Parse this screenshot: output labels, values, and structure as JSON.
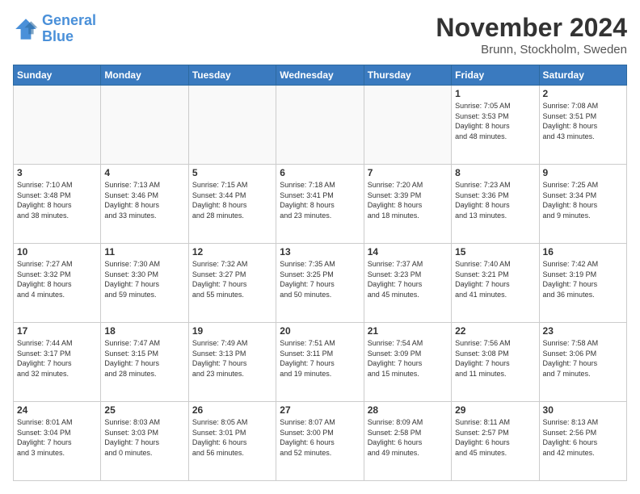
{
  "logo": {
    "line1": "General",
    "line2": "Blue"
  },
  "title": "November 2024",
  "location": "Brunn, Stockholm, Sweden",
  "weekdays": [
    "Sunday",
    "Monday",
    "Tuesday",
    "Wednesday",
    "Thursday",
    "Friday",
    "Saturday"
  ],
  "weeks": [
    [
      {
        "day": "",
        "info": ""
      },
      {
        "day": "",
        "info": ""
      },
      {
        "day": "",
        "info": ""
      },
      {
        "day": "",
        "info": ""
      },
      {
        "day": "",
        "info": ""
      },
      {
        "day": "1",
        "info": "Sunrise: 7:05 AM\nSunset: 3:53 PM\nDaylight: 8 hours\nand 48 minutes."
      },
      {
        "day": "2",
        "info": "Sunrise: 7:08 AM\nSunset: 3:51 PM\nDaylight: 8 hours\nand 43 minutes."
      }
    ],
    [
      {
        "day": "3",
        "info": "Sunrise: 7:10 AM\nSunset: 3:48 PM\nDaylight: 8 hours\nand 38 minutes."
      },
      {
        "day": "4",
        "info": "Sunrise: 7:13 AM\nSunset: 3:46 PM\nDaylight: 8 hours\nand 33 minutes."
      },
      {
        "day": "5",
        "info": "Sunrise: 7:15 AM\nSunset: 3:44 PM\nDaylight: 8 hours\nand 28 minutes."
      },
      {
        "day": "6",
        "info": "Sunrise: 7:18 AM\nSunset: 3:41 PM\nDaylight: 8 hours\nand 23 minutes."
      },
      {
        "day": "7",
        "info": "Sunrise: 7:20 AM\nSunset: 3:39 PM\nDaylight: 8 hours\nand 18 minutes."
      },
      {
        "day": "8",
        "info": "Sunrise: 7:23 AM\nSunset: 3:36 PM\nDaylight: 8 hours\nand 13 minutes."
      },
      {
        "day": "9",
        "info": "Sunrise: 7:25 AM\nSunset: 3:34 PM\nDaylight: 8 hours\nand 9 minutes."
      }
    ],
    [
      {
        "day": "10",
        "info": "Sunrise: 7:27 AM\nSunset: 3:32 PM\nDaylight: 8 hours\nand 4 minutes."
      },
      {
        "day": "11",
        "info": "Sunrise: 7:30 AM\nSunset: 3:30 PM\nDaylight: 7 hours\nand 59 minutes."
      },
      {
        "day": "12",
        "info": "Sunrise: 7:32 AM\nSunset: 3:27 PM\nDaylight: 7 hours\nand 55 minutes."
      },
      {
        "day": "13",
        "info": "Sunrise: 7:35 AM\nSunset: 3:25 PM\nDaylight: 7 hours\nand 50 minutes."
      },
      {
        "day": "14",
        "info": "Sunrise: 7:37 AM\nSunset: 3:23 PM\nDaylight: 7 hours\nand 45 minutes."
      },
      {
        "day": "15",
        "info": "Sunrise: 7:40 AM\nSunset: 3:21 PM\nDaylight: 7 hours\nand 41 minutes."
      },
      {
        "day": "16",
        "info": "Sunrise: 7:42 AM\nSunset: 3:19 PM\nDaylight: 7 hours\nand 36 minutes."
      }
    ],
    [
      {
        "day": "17",
        "info": "Sunrise: 7:44 AM\nSunset: 3:17 PM\nDaylight: 7 hours\nand 32 minutes."
      },
      {
        "day": "18",
        "info": "Sunrise: 7:47 AM\nSunset: 3:15 PM\nDaylight: 7 hours\nand 28 minutes."
      },
      {
        "day": "19",
        "info": "Sunrise: 7:49 AM\nSunset: 3:13 PM\nDaylight: 7 hours\nand 23 minutes."
      },
      {
        "day": "20",
        "info": "Sunrise: 7:51 AM\nSunset: 3:11 PM\nDaylight: 7 hours\nand 19 minutes."
      },
      {
        "day": "21",
        "info": "Sunrise: 7:54 AM\nSunset: 3:09 PM\nDaylight: 7 hours\nand 15 minutes."
      },
      {
        "day": "22",
        "info": "Sunrise: 7:56 AM\nSunset: 3:08 PM\nDaylight: 7 hours\nand 11 minutes."
      },
      {
        "day": "23",
        "info": "Sunrise: 7:58 AM\nSunset: 3:06 PM\nDaylight: 7 hours\nand 7 minutes."
      }
    ],
    [
      {
        "day": "24",
        "info": "Sunrise: 8:01 AM\nSunset: 3:04 PM\nDaylight: 7 hours\nand 3 minutes."
      },
      {
        "day": "25",
        "info": "Sunrise: 8:03 AM\nSunset: 3:03 PM\nDaylight: 7 hours\nand 0 minutes."
      },
      {
        "day": "26",
        "info": "Sunrise: 8:05 AM\nSunset: 3:01 PM\nDaylight: 6 hours\nand 56 minutes."
      },
      {
        "day": "27",
        "info": "Sunrise: 8:07 AM\nSunset: 3:00 PM\nDaylight: 6 hours\nand 52 minutes."
      },
      {
        "day": "28",
        "info": "Sunrise: 8:09 AM\nSunset: 2:58 PM\nDaylight: 6 hours\nand 49 minutes."
      },
      {
        "day": "29",
        "info": "Sunrise: 8:11 AM\nSunset: 2:57 PM\nDaylight: 6 hours\nand 45 minutes."
      },
      {
        "day": "30",
        "info": "Sunrise: 8:13 AM\nSunset: 2:56 PM\nDaylight: 6 hours\nand 42 minutes."
      }
    ]
  ]
}
